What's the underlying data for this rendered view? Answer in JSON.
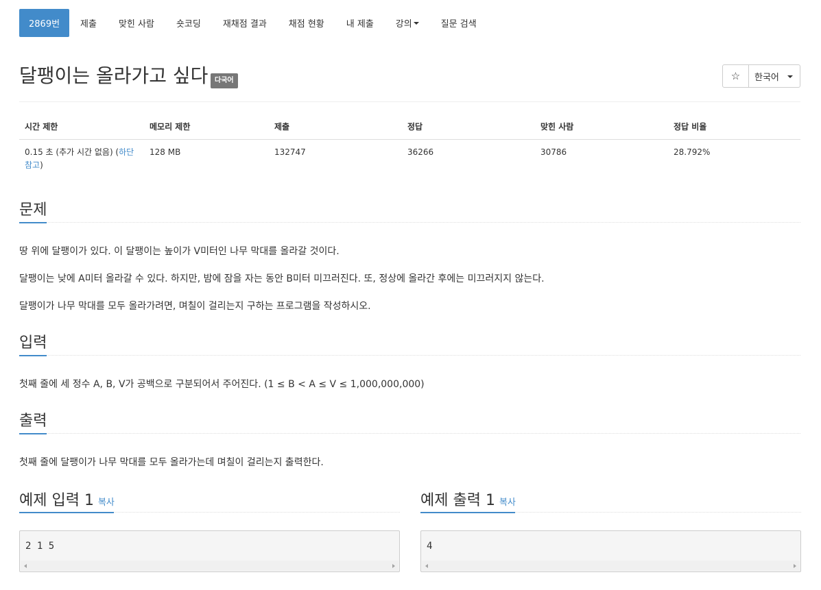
{
  "nav": {
    "tabs": [
      {
        "label": "2869번",
        "active": true
      },
      {
        "label": "제출"
      },
      {
        "label": "맞힌 사람"
      },
      {
        "label": "숏코딩"
      },
      {
        "label": "재채점 결과"
      },
      {
        "label": "채점 현황"
      },
      {
        "label": "내 제출"
      },
      {
        "label": "강의"
      },
      {
        "label": "질문 검색"
      }
    ]
  },
  "header": {
    "title": "달팽이는 올라가고 싶다",
    "badge": "다국어",
    "star": "☆",
    "language": "한국어"
  },
  "info": {
    "headers": [
      "시간 제한",
      "메모리 제한",
      "제출",
      "정답",
      "맞힌 사람",
      "정답 비율"
    ],
    "time_limit": "0.15 초 (추가 시간 없음) (",
    "time_limit_link_1": "하단",
    "time_limit_link_2": "참고",
    "time_limit_end": ")",
    "memory": "128 MB",
    "submissions": "132747",
    "accepted": "36266",
    "solvers": "30786",
    "ratio": "28.792%"
  },
  "problem": {
    "heading": "문제",
    "lines": [
      "땅 위에 달팽이가 있다. 이 달팽이는 높이가 V미터인 나무 막대를 올라갈 것이다.",
      "달팽이는 낮에 A미터 올라갈 수 있다. 하지만, 밤에 잠을 자는 동안 B미터 미끄러진다. 또, 정상에 올라간 후에는 미끄러지지 않는다.",
      "달팽이가 나무 막대를 모두 올라가려면, 며칠이 걸리는지 구하는 프로그램을 작성하시오."
    ]
  },
  "input": {
    "heading": "입력",
    "text": "첫째 줄에 세 정수 A, B, V가 공백으로 구분되어서 주어진다. (1 ≤ B < A ≤ V ≤ 1,000,000,000)"
  },
  "output": {
    "heading": "출력",
    "text": "첫째 줄에 달팽이가 나무 막대를 모두 올라가는데 며칠이 걸리는지 출력한다."
  },
  "samples": {
    "input_heading": "예제 입력 1",
    "output_heading": "예제 출력 1",
    "copy_label": "복사",
    "input_value": "2 1 5",
    "output_value": "4"
  }
}
